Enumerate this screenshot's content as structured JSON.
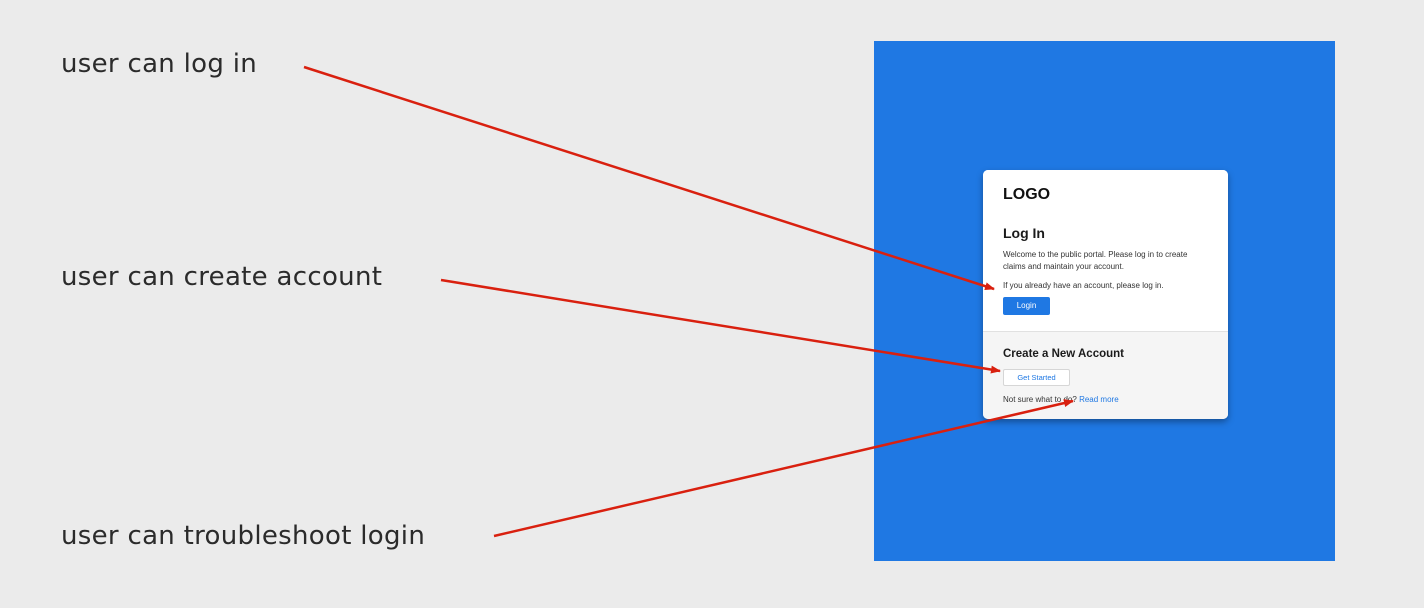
{
  "annotations": {
    "login": "user can log in",
    "create": "user can create account",
    "troubleshoot": "user can troubleshoot login"
  },
  "card": {
    "logo": "LOGO",
    "login_heading": "Log In",
    "welcome_text": "Welcome to the public portal. Please log in to create claims and maintain your account.",
    "already_text": "If you already have an account, please log in.",
    "login_button": "Login",
    "create_heading": "Create a New Account",
    "get_started_button": "Get Started",
    "not_sure_text": "Not sure what to do?",
    "read_more_link": "Read more"
  },
  "colors": {
    "background": "#ebebeb",
    "frame_blue": "#1f78e3",
    "arrow_red": "#d9200f",
    "link_blue": "#1f78e3"
  }
}
